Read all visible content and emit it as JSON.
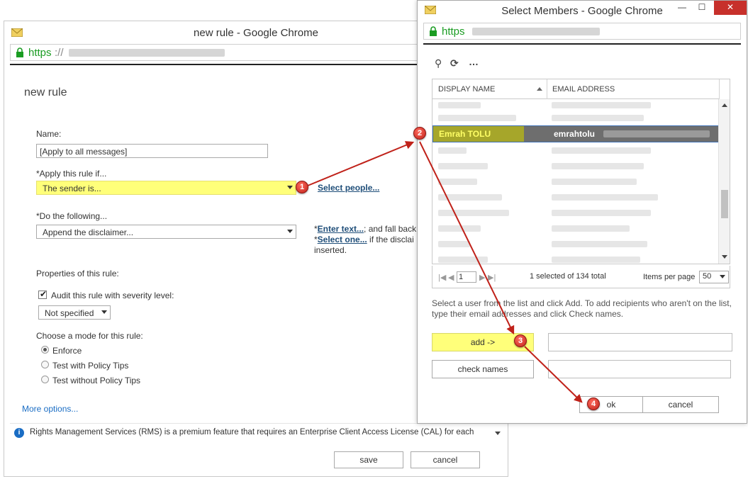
{
  "colors": {
    "highlight": "#ffff7a",
    "arrow": "#c0221a",
    "https": "#1a9c22",
    "link": "#1f4e79"
  },
  "new_rule_window": {
    "title": "new rule - Google Chrome",
    "address_prefix": "https",
    "address_sep": "://",
    "page_title": "new rule",
    "name_label": "Name:",
    "name_value": "[Apply to all messages]",
    "apply_label": "*Apply this rule if...",
    "apply_value": "The sender is...",
    "select_people_link": "Select people...",
    "do_label": "*Do the following...",
    "do_value": "Append the disclaimer...",
    "enter_text_prefix": "*",
    "enter_text_link": "Enter text...",
    "enter_text_suffix": "; and fall back",
    "select_one_prefix": "*",
    "select_one_link": "Select one...",
    "select_one_suffix": " if the disclai",
    "inserted_text": "inserted.",
    "properties_label": "Properties of this rule:",
    "audit_label": "Audit this rule with severity level:",
    "severity_value": "Not specified",
    "mode_label": "Choose a mode for this rule:",
    "modes": [
      "Enforce",
      "Test with Policy Tips",
      "Test without Policy Tips"
    ],
    "more_options": "More options...",
    "rms_notice": "Rights Management Services (RMS) is a premium feature that requires an Enterprise Client Access License (CAL) for each",
    "save_label": "save",
    "cancel_label": "cancel"
  },
  "select_members_window": {
    "title": "Select Members - Google Chrome",
    "address_prefix": "https",
    "controls": {
      "minimize": "—",
      "maximize": "☐",
      "close": "✕"
    },
    "columns": [
      "DISPLAY NAME",
      "EMAIL ADDRESS"
    ],
    "selected_row": {
      "name": "Emrah  TOLU",
      "email": "emrahtolu"
    },
    "pager_status": "1 selected of 134 total",
    "page_number": "1",
    "items_per_page_label": "Items per page",
    "items_per_page_value": "50",
    "hint": "Select a user from the list and click Add. To add recipients who aren't on the list, type their email addresses and click Check names.",
    "add_label": "add ->",
    "check_names_label": "check names",
    "ok_label": "ok",
    "cancel_label": "cancel"
  },
  "markers": [
    "1",
    "2",
    "3",
    "4"
  ]
}
